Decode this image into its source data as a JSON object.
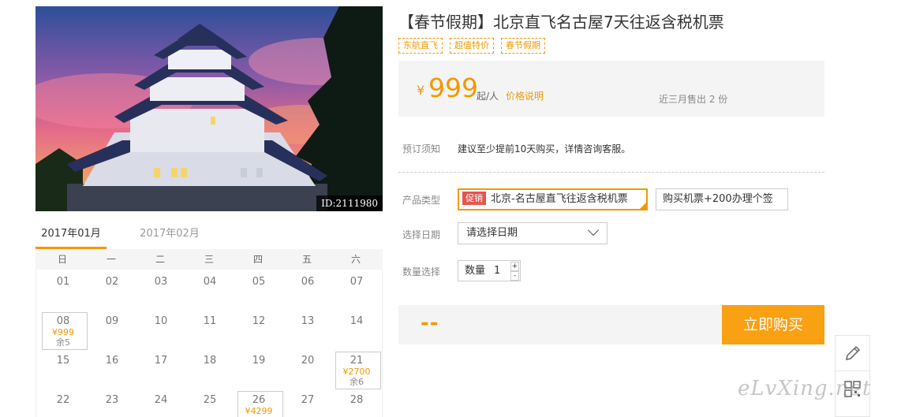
{
  "product": {
    "title": "【春节假期】北京直飞名古屋7天往返含税机票",
    "tags": [
      "东航直飞",
      "超值特价",
      "春节假期"
    ],
    "image_id": "ID:2111980"
  },
  "price": {
    "currency": "¥",
    "amount": "999",
    "unit": "起/人",
    "note_link": "价格说明",
    "sold": "近三月售出 2 份"
  },
  "booking": {
    "notice_label": "预订须知",
    "notice_text": "建议至少提前10天购买，详情咨询客服。",
    "type_label": "产品类型",
    "promo_badge": "促销",
    "type_options": [
      "北京-名古屋直飞往返含税机票",
      "购买机票+200办理个签"
    ],
    "date_label": "选择日期",
    "date_placeholder": "请选择日期",
    "qty_label": "数量选择",
    "qty_field_label": "数量",
    "qty_value": "1",
    "qty_plus": "+",
    "qty_minus": "-",
    "total": "--",
    "buy_button": "立即购买"
  },
  "calendar": {
    "months": [
      "2017年01月",
      "2017年02月"
    ],
    "active_month": 0,
    "weekdays": [
      "日",
      "一",
      "二",
      "三",
      "四",
      "五",
      "六"
    ],
    "days": [
      {
        "d": "01"
      },
      {
        "d": "02"
      },
      {
        "d": "03"
      },
      {
        "d": "04"
      },
      {
        "d": "05"
      },
      {
        "d": "06"
      },
      {
        "d": "07"
      },
      {
        "d": "08",
        "price": "¥999",
        "stock": "余5"
      },
      {
        "d": "09"
      },
      {
        "d": "10"
      },
      {
        "d": "11"
      },
      {
        "d": "12"
      },
      {
        "d": "13"
      },
      {
        "d": "14"
      },
      {
        "d": "15"
      },
      {
        "d": "16"
      },
      {
        "d": "17"
      },
      {
        "d": "18"
      },
      {
        "d": "19"
      },
      {
        "d": "20"
      },
      {
        "d": "21",
        "price": "¥2700",
        "stock": "余6"
      },
      {
        "d": "22"
      },
      {
        "d": "23"
      },
      {
        "d": "24"
      },
      {
        "d": "25"
      },
      {
        "d": "26",
        "price": "¥4299"
      },
      {
        "d": "27"
      },
      {
        "d": "28"
      }
    ]
  },
  "side_tools": {
    "icons": [
      "pencil-icon",
      "qrcode-icon"
    ]
  },
  "watermark": "eLvXing.net",
  "colors": {
    "accent": "#f39800",
    "promo": "#e8544c",
    "panel": "#f4f4f4"
  }
}
